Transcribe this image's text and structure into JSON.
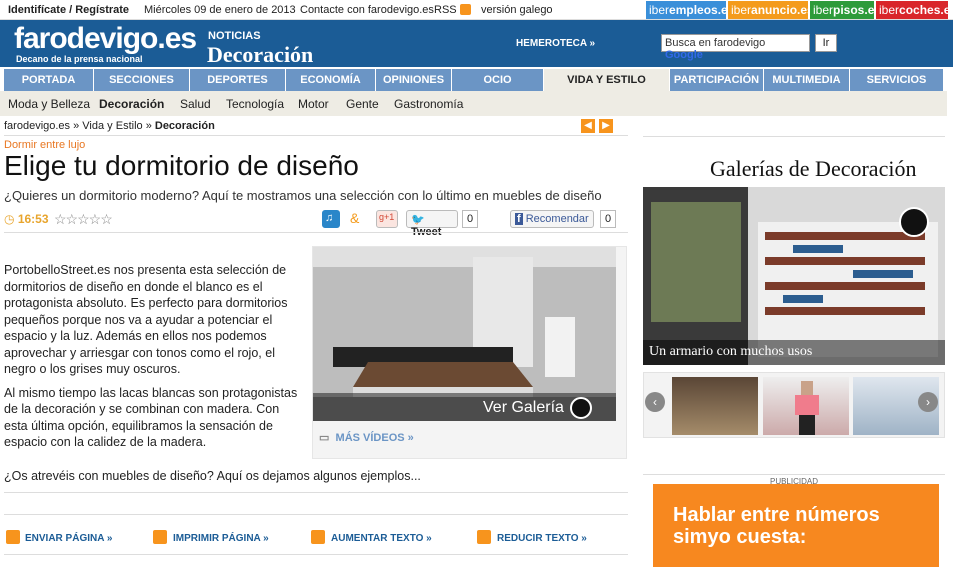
{
  "topbar": {
    "login": "Identifícate / Regístrate",
    "date": "Miércoles 09 de enero de 2013",
    "contact": "Contacte con farodevigo.es",
    "rss": "RSS",
    "galician": "versión galego"
  },
  "partners": [
    {
      "pre": "iber",
      "post": "empleos.es",
      "color": "#3a8fd9"
    },
    {
      "pre": "iber",
      "post": "anuncio.es",
      "color": "#f49b1c"
    },
    {
      "pre": "iber",
      "post": "pisos.es",
      "color": "#2e9b3a"
    },
    {
      "pre": "iber",
      "post": "coches.es",
      "color": "#d9262a"
    }
  ],
  "header": {
    "logo": "farodevigo.es",
    "tagline": "Decano de la prensa nacional",
    "noticias": "NOTICIAS",
    "section": "Decoración",
    "hemeroteca": "HEMEROTECA »",
    "search_placeholder": "Busca en farodevigo",
    "google": "Google",
    "search_button": "Ir"
  },
  "nav": [
    "PORTADA",
    "SECCIONES",
    "DEPORTES",
    "ECONOMÍA",
    "OPINIONES",
    "OCIO",
    "VIDA Y ESTILO",
    "PARTICIPACIÓN",
    "MULTIMEDIA",
    "SERVICIOS"
  ],
  "subnav": [
    "Moda y Belleza",
    "Decoración",
    "Salud",
    "Tecnología",
    "Motor",
    "Gente",
    "Gastronomía"
  ],
  "breadcrumb": {
    "a": "farodevigo.es",
    "sep": "»",
    "b": "Vida y Estilo",
    "c": "Decoración"
  },
  "article": {
    "kicker": "Dormir entre lujo",
    "title": "Elige tu dormitorio de diseño",
    "subtitle": "¿Quieres un dormitorio moderno? Aquí te mostramos una selección con lo último en muebles de diseño",
    "time": "16:53",
    "tweet": "Tweet",
    "tweet_count": "0",
    "recommend": "Recomendar",
    "recommend_count": "0",
    "p1": "PortobelloStreet.es nos presenta esta selección de dormitorios de diseño en donde el blanco es el protagonista absoluto. Es perfecto para dormitorios pequeños porque nos va a ayudar a potenciar el espacio y la luz. Además en ellos nos podemos aprovechar y arriesgar con tonos como el rojo, el negro o los grises muy oscuros.",
    "p2": "Al mismo tiempo las lacas blancas son protagonistas de la decoración y se combinan con madera. Con esta última opción, equilibramos la sensación de espacio con la calidez de la madera.",
    "closing": "¿Os atrevéis con muebles de diseño? Aquí os dejamos algunos ejemplos...",
    "ver_galeria": "Ver Galería",
    "mas_videos": "MÁS VÍDEOS »"
  },
  "footer_links": [
    "ENVIAR PÁGINA »",
    "IMPRIMIR PÁGINA »",
    "AUMENTAR TEXTO »",
    "REDUCIR TEXTO »"
  ],
  "sidebar": {
    "gallery_title": "Galerías de Decoración",
    "caption": "Un armario con muchos usos",
    "publicidad": "PUBLICIDAD",
    "ad_text": "Hablar entre números simyo cuesta:"
  }
}
